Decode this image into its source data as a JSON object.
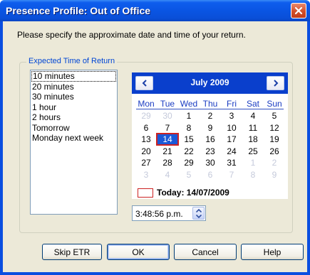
{
  "window": {
    "title": "Presence Profile: Out of Office"
  },
  "instruction": "Please specify the approximate date and time of your return.",
  "group": {
    "label": "Expected Time of Return"
  },
  "durations": [
    "10 minutes",
    "20 minutes",
    "30 minutes",
    "1 hour",
    "2 hours",
    "Tomorrow",
    "Monday next week"
  ],
  "calendar": {
    "month_label": "July 2009",
    "weekdays": [
      "Mon",
      "Tue",
      "Wed",
      "Thu",
      "Fri",
      "Sat",
      "Sun"
    ],
    "weeks": [
      [
        "29",
        "30",
        "1",
        "2",
        "3",
        "4",
        "5"
      ],
      [
        "6",
        "7",
        "8",
        "9",
        "10",
        "11",
        "12"
      ],
      [
        "13",
        "14",
        "15",
        "16",
        "17",
        "18",
        "19"
      ],
      [
        "20",
        "21",
        "22",
        "23",
        "24",
        "25",
        "26"
      ],
      [
        "27",
        "28",
        "29",
        "30",
        "31",
        "1",
        "2"
      ],
      [
        "3",
        "4",
        "5",
        "6",
        "7",
        "8",
        "9"
      ]
    ],
    "selected_day": "14",
    "today_label": "Today: 14/07/2009"
  },
  "time": {
    "value": "3:48:56 p.m."
  },
  "buttons": {
    "skip": "Skip ETR",
    "ok": "OK",
    "cancel": "Cancel",
    "help": "Help"
  },
  "colors": {
    "titlebar": "#0a55e3",
    "calendar_header": "#0a3fcc",
    "selected_day": "#1a58d7",
    "today_marker": "#cc2222",
    "weekday_text": "#1a3cc2",
    "group_label": "#0046d5"
  },
  "icons": {
    "close": "close-icon",
    "prev": "chevron-left-icon",
    "next": "chevron-right-icon",
    "spin_up": "caret-up-icon",
    "spin_down": "caret-down-icon"
  }
}
